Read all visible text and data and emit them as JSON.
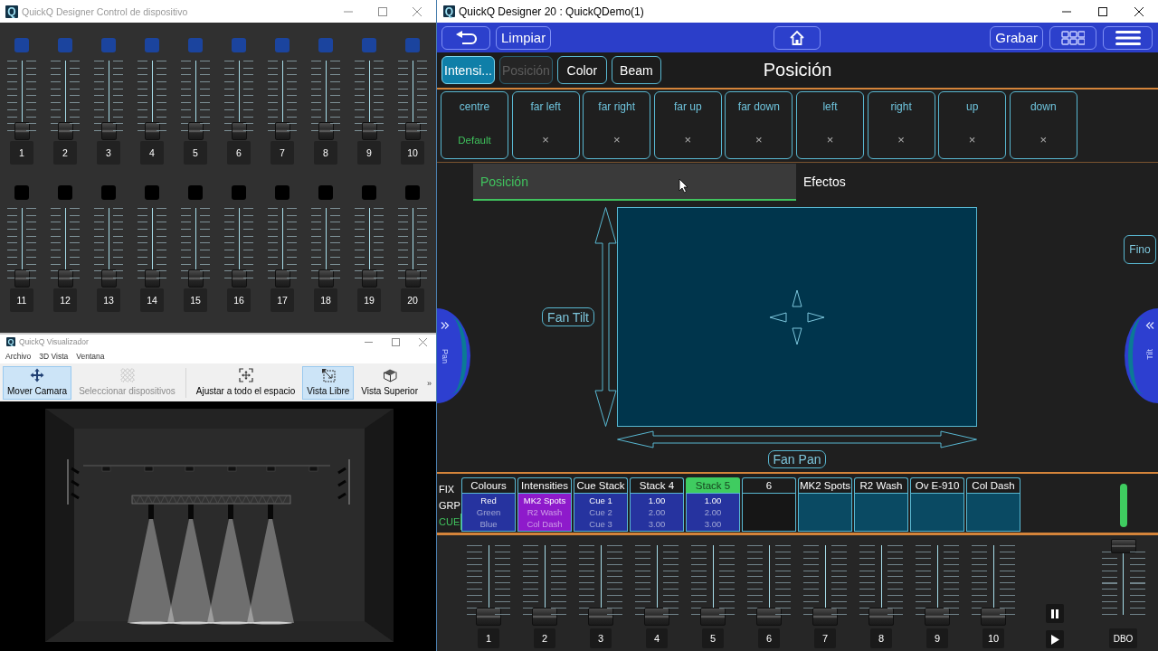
{
  "device_control_window": {
    "logo": "Q",
    "title": "QuickQ Designer Control de dispositivo",
    "banks": [
      {
        "channels": [
          {
            "number": "1",
            "on": true,
            "level": 0
          },
          {
            "number": "2",
            "on": true,
            "level": 0
          },
          {
            "number": "3",
            "on": true,
            "level": 0
          },
          {
            "number": "4",
            "on": true,
            "level": 0
          },
          {
            "number": "5",
            "on": true,
            "level": 0
          },
          {
            "number": "6",
            "on": true,
            "level": 0
          },
          {
            "number": "7",
            "on": true,
            "level": 0
          },
          {
            "number": "8",
            "on": true,
            "level": 0
          },
          {
            "number": "9",
            "on": true,
            "level": 0
          },
          {
            "number": "10",
            "on": true,
            "level": 0
          }
        ]
      },
      {
        "channels": [
          {
            "number": "11",
            "on": false,
            "level": 0
          },
          {
            "number": "12",
            "on": false,
            "level": 0
          },
          {
            "number": "13",
            "on": false,
            "level": 0
          },
          {
            "number": "14",
            "on": false,
            "level": 0
          },
          {
            "number": "15",
            "on": false,
            "level": 0
          },
          {
            "number": "16",
            "on": false,
            "level": 0
          },
          {
            "number": "17",
            "on": false,
            "level": 0
          },
          {
            "number": "18",
            "on": false,
            "level": 0
          },
          {
            "number": "19",
            "on": false,
            "level": 0
          },
          {
            "number": "20",
            "on": false,
            "level": 0
          }
        ]
      }
    ]
  },
  "visualizer_window": {
    "logo": "Q",
    "title": "QuickQ Visualizador",
    "menu": [
      "Archivo",
      "3D Vista",
      "Ventana"
    ],
    "toolbar": [
      {
        "kind": "move",
        "label": "Mover Camara",
        "selected": true,
        "disabled": false
      },
      {
        "kind": "select",
        "label": "Seleccionar dispositivos",
        "selected": false,
        "disabled": true
      },
      {
        "kind": "fit",
        "label": "Ajustar a todo el espacio",
        "selected": false,
        "disabled": false
      },
      {
        "kind": "free",
        "label": "Vista Libre",
        "selected": true,
        "disabled": false
      },
      {
        "kind": "top",
        "label": "Vista Superior",
        "selected": false,
        "disabled": false
      }
    ],
    "overflow": "»"
  },
  "designer_window": {
    "logo": "Q",
    "title": "QuickQ Designer 20 : QuickQDemo(1)",
    "toolbar": {
      "left": [
        {
          "kind": "back"
        },
        {
          "kind": "text",
          "label": "Limpiar"
        }
      ],
      "center": [
        {
          "kind": "home"
        }
      ],
      "right": [
        {
          "kind": "text",
          "label": "Grabar"
        },
        {
          "kind": "grid"
        },
        {
          "kind": "menu"
        }
      ]
    },
    "feature_tabs": [
      {
        "label": "Intensi...",
        "selected": false,
        "active": true
      },
      {
        "label": "Posición",
        "selected": true,
        "active": false
      },
      {
        "label": "Color",
        "selected": false,
        "active": false
      },
      {
        "label": "Beam",
        "selected": false,
        "active": false
      }
    ],
    "heading": "Posición",
    "presets": [
      {
        "label": "centre",
        "value": "Default",
        "active": true
      },
      {
        "label": "far left",
        "value": "×",
        "active": false
      },
      {
        "label": "far right",
        "value": "×",
        "active": false
      },
      {
        "label": "far up",
        "value": "×",
        "active": false
      },
      {
        "label": "far down",
        "value": "×",
        "active": false
      },
      {
        "label": "left",
        "value": "×",
        "active": false
      },
      {
        "label": "right",
        "value": "×",
        "active": false
      },
      {
        "label": "up",
        "value": "×",
        "active": false
      },
      {
        "label": "down",
        "value": "×",
        "active": false
      }
    ],
    "position_tabs": [
      {
        "label": "Posición",
        "selected": true
      },
      {
        "label": "Efectos",
        "selected": false
      }
    ],
    "pan_wheel": {
      "label": "Pan"
    },
    "tilt_wheel": {
      "label": "Tilt"
    },
    "xy_pad": {
      "fan_tilt": "Fan Tilt",
      "fan_pan": "Fan Pan"
    },
    "fine_button": "Fino",
    "playback": {
      "modes": [
        {
          "label": "FIX",
          "selected": false
        },
        {
          "label": "GRP",
          "selected": false
        },
        {
          "label": "CUE",
          "selected": true
        }
      ],
      "slots": [
        {
          "title": "Colours",
          "selected": false,
          "color": "#26339f",
          "lines": [
            {
              "text": "Red",
              "current": true
            },
            {
              "text": "Green",
              "current": false
            },
            {
              "text": "Blue",
              "current": false
            }
          ]
        },
        {
          "title": "Intensities",
          "selected": false,
          "color": "#8e1acb",
          "lines": [
            {
              "text": "MK2 Spots",
              "current": true
            },
            {
              "text": "R2 Wash",
              "current": false
            },
            {
              "text": "Col Dash",
              "current": false
            }
          ]
        },
        {
          "title": "Cue Stack",
          "selected": false,
          "color": "#26339f",
          "lines": [
            {
              "text": "Cue 1",
              "current": true
            },
            {
              "text": "Cue 2",
              "current": false
            },
            {
              "text": "Cue 3",
              "current": false
            }
          ]
        },
        {
          "title": "Stack 4",
          "selected": false,
          "color": "#26339f",
          "lines": [
            {
              "text": "1.00",
              "current": true
            },
            {
              "text": "2.00",
              "current": false
            },
            {
              "text": "3.00",
              "current": false
            }
          ]
        },
        {
          "title": "Stack 5",
          "selected": true,
          "color": "#26339f",
          "lines": [
            {
              "text": "1.00",
              "current": true
            },
            {
              "text": "2.00",
              "current": false
            },
            {
              "text": "3.00",
              "current": false
            }
          ]
        },
        {
          "title": "6",
          "selected": false,
          "color": "#161616"
        },
        {
          "title": "MK2 Spots",
          "selected": false,
          "color": "#0a4a63"
        },
        {
          "title": "R2 Wash",
          "selected": false,
          "color": "#0a4a63"
        },
        {
          "title": "Ov E-910",
          "selected": false,
          "color": "#0a4a63"
        },
        {
          "title": "Col Dash",
          "selected": false,
          "color": "#0a4a63"
        }
      ]
    },
    "faders": [
      {
        "number": "1",
        "level": 0
      },
      {
        "number": "2",
        "level": 0
      },
      {
        "number": "3",
        "level": 0
      },
      {
        "number": "4",
        "level": 0
      },
      {
        "number": "5",
        "level": 0
      },
      {
        "number": "6",
        "level": 0
      },
      {
        "number": "7",
        "level": 0
      },
      {
        "number": "8",
        "level": 0
      },
      {
        "number": "9",
        "level": 0
      },
      {
        "number": "10",
        "level": 0
      }
    ],
    "master": {
      "label": "DBO",
      "level": 1
    }
  }
}
